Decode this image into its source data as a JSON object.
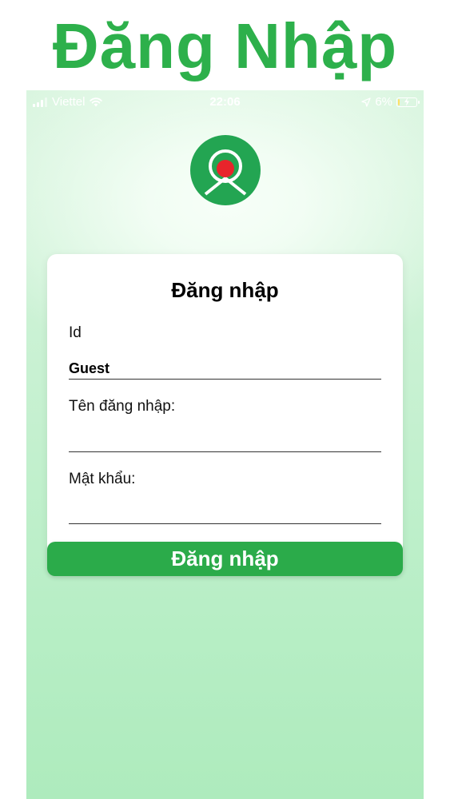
{
  "page_heading": "Đăng Nhập",
  "status_bar": {
    "carrier": "Viettel",
    "time": "22:06",
    "battery": "6%",
    "battery_level": 0.06,
    "icons": [
      "signal-icon",
      "wifi-icon",
      "location-icon",
      "battery-icon",
      "charging-bolt-icon"
    ]
  },
  "logo": {
    "name": "app-logo",
    "colors": {
      "ring": "#23a552",
      "dot": "#e8242b",
      "inner": "#ffffff"
    }
  },
  "login_card": {
    "title": "Đăng nhập",
    "id_label": "Id",
    "id_value": "Guest",
    "username_label": "Tên đăng nhập:",
    "username_value": "",
    "password_label": "Mật khẩu:",
    "password_value": ""
  },
  "submit_button": {
    "label": "Đăng nhập"
  },
  "colors": {
    "accent": "#2bab4a",
    "heading": "#2db04b",
    "background_top": "#d9f5df",
    "background_bottom": "#aeebbd"
  }
}
